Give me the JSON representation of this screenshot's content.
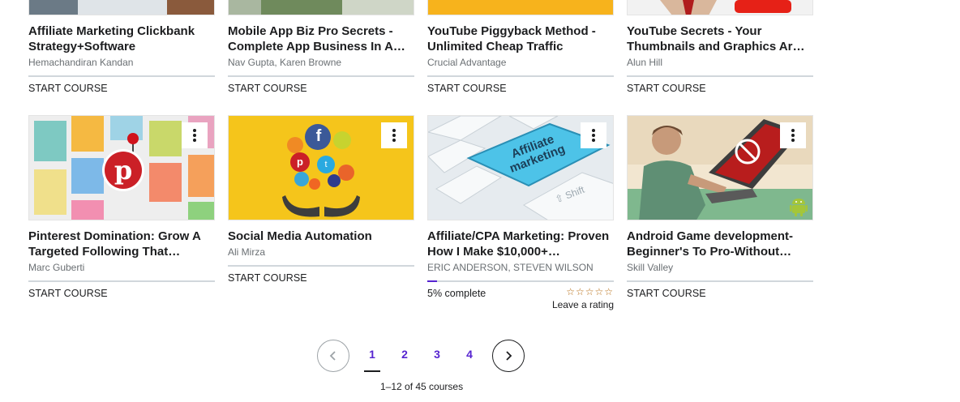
{
  "top_row": [
    {
      "title": "Affiliate Marketing Clickbank Strategy+Software",
      "author": "Hemachandiran Kandan",
      "action": "START COURSE"
    },
    {
      "title": "Mobile App Biz Pro Secrets - Complete App Business In A…",
      "author": "Nav Gupta, Karen Browne",
      "action": "START COURSE"
    },
    {
      "title": "YouTube Piggyback Method - Unlimited Cheap Traffic",
      "author": "Crucial Advantage",
      "action": "START COURSE"
    },
    {
      "title": "YouTube Secrets - Your Thumbnails and Graphics Ar…",
      "author": "Alun Hill",
      "action": "START COURSE"
    }
  ],
  "bottom_row": [
    {
      "title": "Pinterest Domination: Grow A Targeted Following That…",
      "author": "Marc Guberti",
      "action": "START COURSE"
    },
    {
      "title": "Social Media Automation",
      "author": "Ali Mirza",
      "action": "START COURSE"
    },
    {
      "title": "Affiliate/CPA Marketing: Proven How I Make $10,000+…",
      "author": "ERIC ANDERSON, STEVEN WILSON",
      "progress_label": "5% complete",
      "progress": 0.05,
      "stars": "☆☆☆☆☆",
      "rating_label": "Leave a rating"
    },
    {
      "title": "Android Game development- Beginner's To Pro-Without…",
      "author": "Skill Valley",
      "action": "START COURSE"
    }
  ],
  "thumbs": {
    "affiliate_text_line1": "Affiliate",
    "affiliate_text_line2": "marketing",
    "shift_key": "⇧ Shift"
  },
  "pagination": {
    "pages": [
      "1",
      "2",
      "3",
      "4"
    ],
    "current": 1,
    "summary": "1–12 of 45 courses"
  },
  "colors": {
    "accent": "#5624d0",
    "text": "#1c1d1f",
    "muted": "#6a6f73",
    "star": "#b4690e"
  },
  "icons": [
    "kebab-menu-icon",
    "chevron-left-icon",
    "chevron-right-icon",
    "pinterest-icon",
    "facebook-icon",
    "twitter-icon",
    "android-icon"
  ]
}
